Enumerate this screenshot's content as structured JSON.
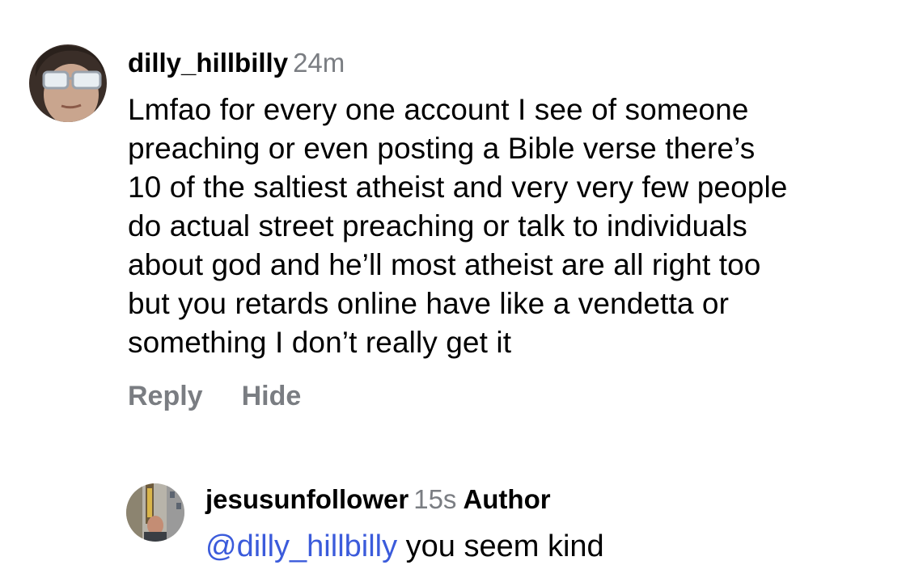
{
  "comment": {
    "username": "dilly_hillbilly",
    "time": "24m",
    "body_lines": [
      "Lmfao for every one account I see of someone",
      "preaching or even posting a Bible verse there’s",
      "10 of the saltiest atheist and very very few people",
      "do actual street preaching or talk to individuals",
      "about god and he’ll most atheist are all right too",
      "but you retards online have like a vendetta or",
      "something I don’t really get it"
    ],
    "reply_label": "Reply",
    "hide_label": "Hide"
  },
  "reply": {
    "username": "jesusunfollower",
    "time": "15s",
    "badge": "Author",
    "mention": "@dilly_hillbilly",
    "text": " you seem kind"
  },
  "colors": {
    "muted": "#7a7d82",
    "mention": "#3b5bdb"
  }
}
